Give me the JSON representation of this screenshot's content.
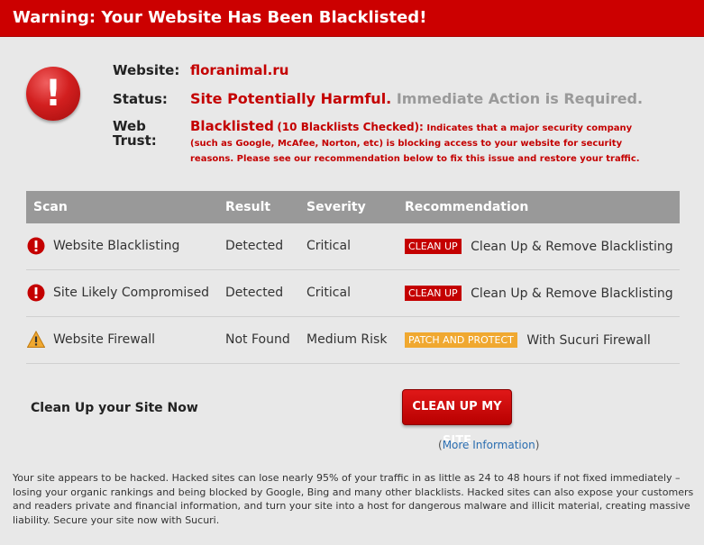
{
  "banner": {
    "title": "Warning: Your Website Has Been Blacklisted!"
  },
  "alert_icon": {
    "glyph": "!"
  },
  "info": {
    "website_label": "Website:",
    "website_value": "floranimal.ru",
    "status_label": "Status:",
    "status_value_harmful": "Site Potentially Harmful.",
    "status_value_action": "Immediate Action is Required.",
    "trust_label": "Web Trust:",
    "trust_value_title": "Blacklisted",
    "trust_value_count": "(10 Blacklists Checked):",
    "trust_value_desc": "Indicates that a major security company (such as Google, McAfee, Norton, etc) is blocking access to your website for security reasons. Please see our recommendation below to fix this issue and restore your traffic."
  },
  "table": {
    "headers": [
      "Scan",
      "Result",
      "Severity",
      "Recommendation"
    ],
    "rows": [
      {
        "icon": "error-icon",
        "scan": "Website Blacklisting",
        "result": "Detected",
        "severity": "Critical",
        "tag": "CLEAN UP",
        "tag_color": "#c40000",
        "recommendation": "Clean Up & Remove Blacklisting"
      },
      {
        "icon": "error-icon",
        "scan": "Site Likely Compromised",
        "result": "Detected",
        "severity": "Critical",
        "tag": "CLEAN UP",
        "tag_color": "#c40000",
        "recommendation": "Clean Up & Remove Blacklisting"
      },
      {
        "icon": "warning-icon",
        "scan": "Website Firewall",
        "result": "Not Found",
        "severity": "Medium Risk",
        "tag": "PATCH AND PROTECT",
        "tag_color": "#f0a830",
        "recommendation": "With Sucuri Firewall"
      }
    ]
  },
  "cta": {
    "text": "Clean Up your Site Now",
    "button_label": "CLEAN UP MY SITE",
    "more_info_open": "(",
    "more_info_link": "More Information",
    "more_info_close": ")"
  },
  "footer": {
    "text": "Your site appears to be hacked. Hacked sites can lose nearly 95% of your traffic in as little as 24 to 48 hours if not fixed immediately – losing your organic rankings and being blocked by Google, Bing and many other blacklists. Hacked sites can also expose your customers and readers private and financial information, and turn your site into a host for dangerous malware and illicit material, creating massive liability. Secure your site now with Sucuri."
  },
  "colors": {
    "brand_red": "#cc0000",
    "header_gray": "#999999",
    "warning_orange": "#f0a830",
    "link_blue": "#2a6db0"
  }
}
